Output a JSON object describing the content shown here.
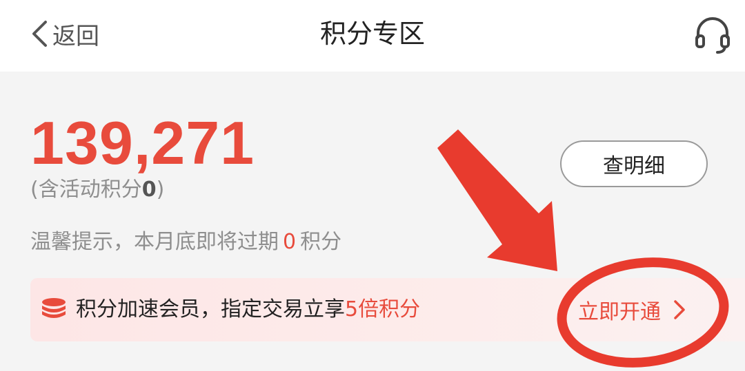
{
  "header": {
    "back_label": "返回",
    "title": "积分专区",
    "support_icon": "headset-icon"
  },
  "points": {
    "total": "139,271",
    "activity_prefix": "(含活动积分",
    "activity_value": "0",
    "activity_suffix": ")",
    "detail_button": "查明细"
  },
  "tip": {
    "prefix": "温馨提示，本月底即将过期",
    "expire_value": "0",
    "suffix": "积分"
  },
  "banner": {
    "icon": "coin-stack-icon",
    "text": "积分加速会员，指定交易立享",
    "highlight": "5倍积分",
    "action_label": "立即开通"
  },
  "colors": {
    "accent": "#e84b3c",
    "annotation": "#e83b2e"
  }
}
